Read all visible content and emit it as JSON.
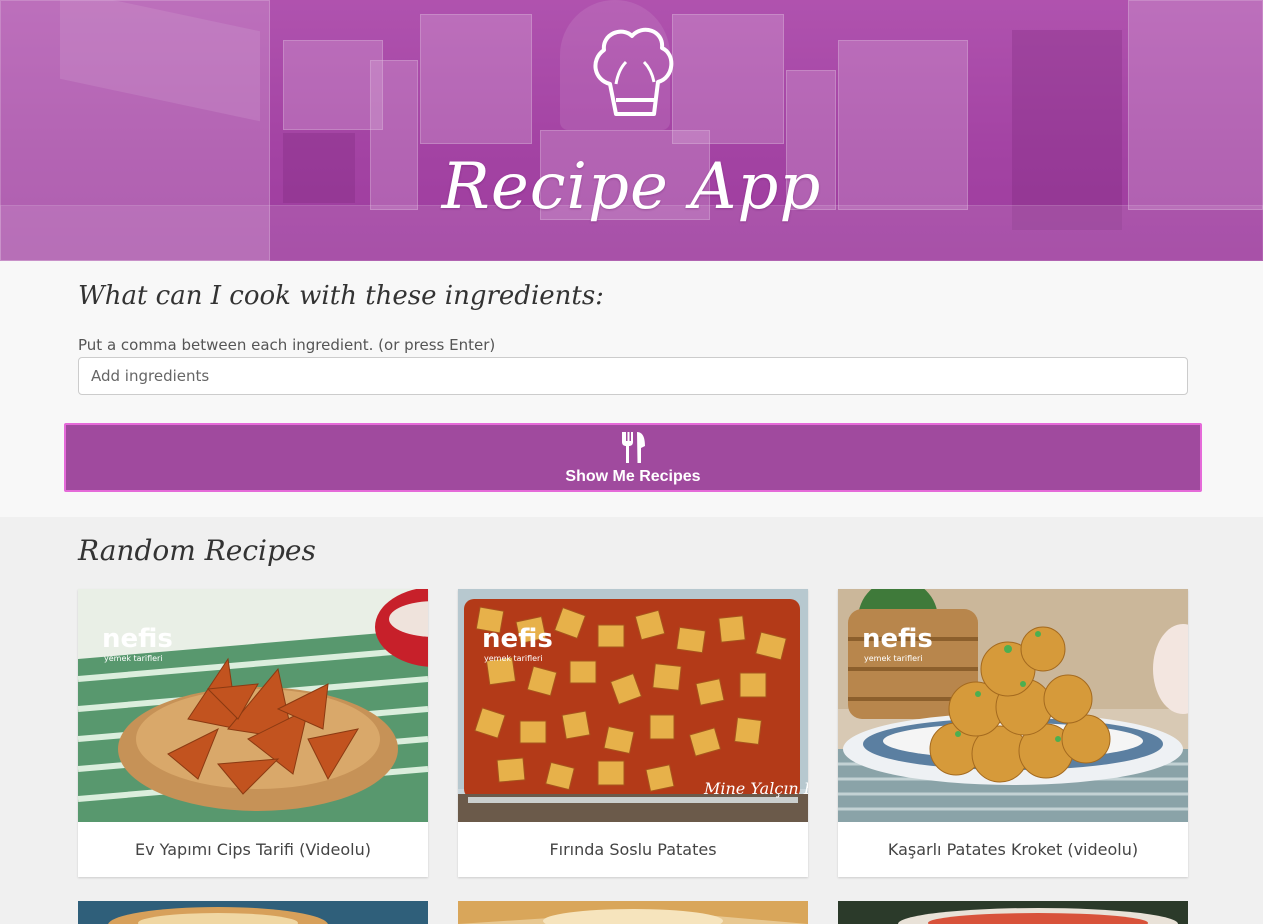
{
  "app": {
    "title": "Recipe App",
    "icon": "chef-hat-icon"
  },
  "search": {
    "heading": "What can I cook with these ingredients:",
    "hint": "Put a comma between each ingredient. (or press Enter)",
    "input_placeholder": "Add ingredients",
    "input_value": "",
    "button_label": "Show Me Recipes",
    "button_icon": "fork-knife-icon"
  },
  "random": {
    "heading": "Random Recipes",
    "cards": [
      {
        "name": "Ev Yapımı Cips Tarifi (Videolu)",
        "logo": "nefis",
        "logo_sub": "yemek tarifleri"
      },
      {
        "name": "Fırında Soslu Patates",
        "logo": "nefis",
        "logo_sub": "yemek tarifleri",
        "watermark": "Mine Yalçın Budak"
      },
      {
        "name": "Kaşarlı Patates Kroket (videolu)",
        "logo": "nefis",
        "logo_sub": "yemek tarifleri"
      }
    ]
  },
  "colors": {
    "accent": "#a04a9e",
    "accent_border": "#e56ad9",
    "hero": "#a648a6"
  }
}
